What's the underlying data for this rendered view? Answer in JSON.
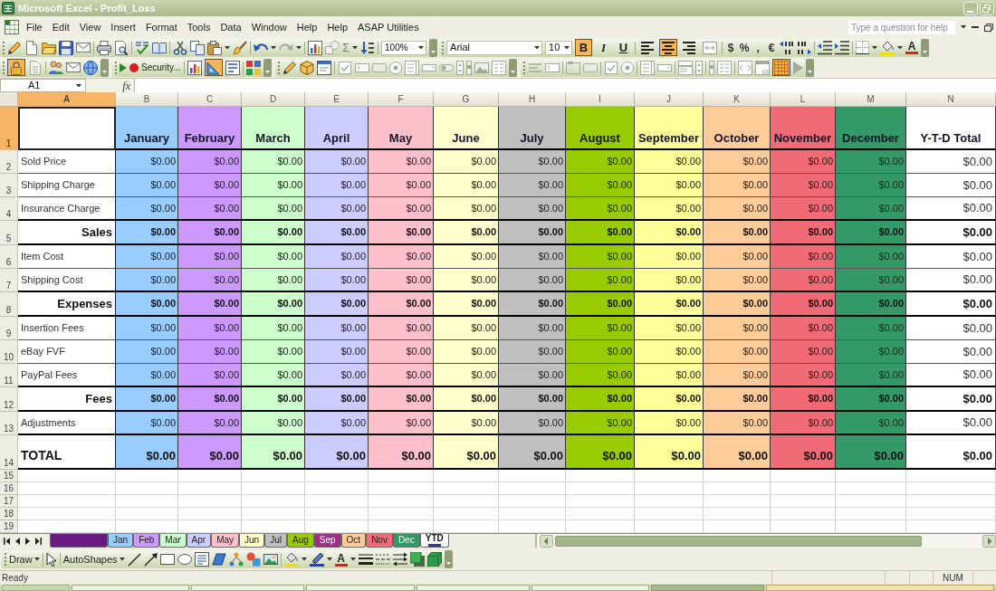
{
  "window": {
    "title": "Microsoft Excel - Profit_Loss"
  },
  "menu_bar": {
    "items": [
      "File",
      "Edit",
      "View",
      "Insert",
      "Format",
      "Tools",
      "Data",
      "Window",
      "Help",
      "Help",
      "ASAP Utilities"
    ],
    "help_box": {
      "placeholder": "Type a question for help"
    }
  },
  "standard_toolbar": {
    "autosum": "Σ",
    "zoom": "100%"
  },
  "formatting_toolbar": {
    "font": "Arial",
    "size": "10",
    "style_buttons": [
      {
        "label": "B",
        "on": true
      },
      {
        "label": "I",
        "on": false
      },
      {
        "label": "U",
        "on": false
      }
    ],
    "alignment_buttons": [
      {
        "kind": "left",
        "on": false
      },
      {
        "kind": "center",
        "on": true
      },
      {
        "kind": "right",
        "on": false
      },
      {
        "kind": "merge",
        "on": false
      }
    ],
    "number_buttons": [
      "$",
      "%",
      ",",
      "€"
    ],
    "font_color": "A"
  },
  "toolbar_3": {
    "security": "Security...",
    "toggles": [
      {
        "kind": "padlock",
        "on": true
      },
      {
        "kind": "set-square",
        "on": true
      },
      {
        "kind": "grid",
        "on": true
      }
    ]
  },
  "formula_bar": {
    "name_box": "A1",
    "function_label": "fx"
  },
  "sheet": {
    "columns": [
      {
        "label": "A",
        "selected": true
      },
      {
        "label": "B",
        "selected": false
      },
      {
        "label": "C",
        "selected": false
      },
      {
        "label": "D",
        "selected": false
      },
      {
        "label": "E",
        "selected": false
      },
      {
        "label": "F",
        "selected": false
      },
      {
        "label": "G",
        "selected": false
      },
      {
        "label": "H",
        "selected": false
      },
      {
        "label": "I",
        "selected": false
      },
      {
        "label": "J",
        "selected": false
      },
      {
        "label": "K",
        "selected": false
      },
      {
        "label": "L",
        "selected": false
      },
      {
        "label": "M",
        "selected": false
      },
      {
        "label": "N",
        "selected": false
      }
    ],
    "row_headers": [
      {
        "label": "1",
        "selected": true
      },
      {
        "label": "2",
        "selected": false
      },
      {
        "label": "3",
        "selected": false
      },
      {
        "label": "4",
        "selected": false
      },
      {
        "label": "5",
        "selected": false
      },
      {
        "label": "6",
        "selected": false
      },
      {
        "label": "7",
        "selected": false
      },
      {
        "label": "8",
        "selected": false
      },
      {
        "label": "9",
        "selected": false
      },
      {
        "label": "10",
        "selected": false
      },
      {
        "label": "11",
        "selected": false
      },
      {
        "label": "12",
        "selected": false
      },
      {
        "label": "13",
        "selected": false
      },
      {
        "label": "14",
        "selected": false
      },
      {
        "label": "15",
        "selected": false
      },
      {
        "label": "16",
        "selected": false
      },
      {
        "label": "17",
        "selected": false
      },
      {
        "label": "18",
        "selected": false
      },
      {
        "label": "19",
        "selected": false
      }
    ],
    "months": [
      {
        "label": "January",
        "color": "#99ccff"
      },
      {
        "label": "February",
        "color": "#cc99ff"
      },
      {
        "label": "March",
        "color": "#ccffcc"
      },
      {
        "label": "April",
        "color": "#ccccff"
      },
      {
        "label": "May",
        "color": "#ffc0cb"
      },
      {
        "label": "June",
        "color": "#ffffcc"
      },
      {
        "label": "July",
        "color": "#bfbfbf"
      },
      {
        "label": "August",
        "color": "#99cc00"
      },
      {
        "label": "September",
        "color": "#ffff99"
      },
      {
        "label": "October",
        "color": "#ffcc99"
      },
      {
        "label": "November",
        "color": "#f06b75"
      },
      {
        "label": "December",
        "color": "#339966"
      },
      {
        "label": "Y-T-D Total",
        "color": "#ffffff"
      }
    ],
    "rows": [
      {
        "label": "Sold Price",
        "kind": "item",
        "values": [
          "$0.00",
          "$0.00",
          "$0.00",
          "$0.00",
          "$0.00",
          "$0.00",
          "$0.00",
          "$0.00",
          "$0.00",
          "$0.00",
          "$0.00",
          "$0.00",
          "$0.00"
        ]
      },
      {
        "label": "Shipping Charge",
        "kind": "item",
        "values": [
          "$0.00",
          "$0.00",
          "$0.00",
          "$0.00",
          "$0.00",
          "$0.00",
          "$0.00",
          "$0.00",
          "$0.00",
          "$0.00",
          "$0.00",
          "$0.00",
          "$0.00"
        ]
      },
      {
        "label": "Insurance Charge",
        "kind": "item",
        "values": [
          "$0.00",
          "$0.00",
          "$0.00",
          "$0.00",
          "$0.00",
          "$0.00",
          "$0.00",
          "$0.00",
          "$0.00",
          "$0.00",
          "$0.00",
          "$0.00",
          "$0.00"
        ]
      },
      {
        "label": "Sales",
        "kind": "subtotal",
        "values": [
          "$0.00",
          "$0.00",
          "$0.00",
          "$0.00",
          "$0.00",
          "$0.00",
          "$0.00",
          "$0.00",
          "$0.00",
          "$0.00",
          "$0.00",
          "$0.00",
          "$0.00"
        ]
      },
      {
        "label": "Item Cost",
        "kind": "item",
        "values": [
          "$0.00",
          "$0.00",
          "$0.00",
          "$0.00",
          "$0.00",
          "$0.00",
          "$0.00",
          "$0.00",
          "$0.00",
          "$0.00",
          "$0.00",
          "$0.00",
          "$0.00"
        ]
      },
      {
        "label": "Shipping Cost",
        "kind": "item",
        "values": [
          "$0.00",
          "$0.00",
          "$0.00",
          "$0.00",
          "$0.00",
          "$0.00",
          "$0.00",
          "$0.00",
          "$0.00",
          "$0.00",
          "$0.00",
          "$0.00",
          "$0.00"
        ]
      },
      {
        "label": "Expenses",
        "kind": "subtotal",
        "values": [
          "$0.00",
          "$0.00",
          "$0.00",
          "$0.00",
          "$0.00",
          "$0.00",
          "$0.00",
          "$0.00",
          "$0.00",
          "$0.00",
          "$0.00",
          "$0.00",
          "$0.00"
        ]
      },
      {
        "label": "Insertion Fees",
        "kind": "item",
        "values": [
          "$0.00",
          "$0.00",
          "$0.00",
          "$0.00",
          "$0.00",
          "$0.00",
          "$0.00",
          "$0.00",
          "$0.00",
          "$0.00",
          "$0.00",
          "$0.00",
          "$0.00"
        ]
      },
      {
        "label": "eBay FVF",
        "kind": "item",
        "values": [
          "$0.00",
          "$0.00",
          "$0.00",
          "$0.00",
          "$0.00",
          "$0.00",
          "$0.00",
          "$0.00",
          "$0.00",
          "$0.00",
          "$0.00",
          "$0.00",
          "$0.00"
        ]
      },
      {
        "label": "PayPal Fees",
        "kind": "item",
        "values": [
          "$0.00",
          "$0.00",
          "$0.00",
          "$0.00",
          "$0.00",
          "$0.00",
          "$0.00",
          "$0.00",
          "$0.00",
          "$0.00",
          "$0.00",
          "$0.00",
          "$0.00"
        ]
      },
      {
        "label": "Fees",
        "kind": "subtotal",
        "values": [
          "$0.00",
          "$0.00",
          "$0.00",
          "$0.00",
          "$0.00",
          "$0.00",
          "$0.00",
          "$0.00",
          "$0.00",
          "$0.00",
          "$0.00",
          "$0.00",
          "$0.00"
        ]
      },
      {
        "label": "Adjustments",
        "kind": "item",
        "values": [
          "$0.00",
          "$0.00",
          "$0.00",
          "$0.00",
          "$0.00",
          "$0.00",
          "$0.00",
          "$0.00",
          "$0.00",
          "$0.00",
          "$0.00",
          "$0.00",
          "$0.00"
        ]
      },
      {
        "label": "TOTAL",
        "kind": "total",
        "values": [
          "$0.00",
          "$0.00",
          "$0.00",
          "$0.00",
          "$0.00",
          "$0.00",
          "$0.00",
          "$0.00",
          "$0.00",
          "$0.00",
          "$0.00",
          "$0.00",
          "$0.00"
        ]
      }
    ]
  },
  "sheet_tabs": [
    {
      "color": "#6a1b7f",
      "selected": false
    },
    {
      "label": "Jan",
      "color": "#99ccff",
      "selected": false
    },
    {
      "label": "Feb",
      "color": "#cc99ff",
      "selected": false
    },
    {
      "label": "Mar",
      "color": "#ccffcc",
      "selected": false
    },
    {
      "label": "Apr",
      "color": "#ccccff",
      "selected": false
    },
    {
      "label": "May",
      "color": "#ffc0cb",
      "selected": false
    },
    {
      "label": "Jun",
      "color": "#ffffcc",
      "selected": false
    },
    {
      "label": "Jul",
      "color": "#bfbfbf",
      "selected": false
    },
    {
      "label": "Aug",
      "color": "#99cc00",
      "selected": false
    },
    {
      "label": "Sep",
      "color": "#9c2f86",
      "selected": false
    },
    {
      "label": "Oct",
      "color": "#ffcc99",
      "selected": false
    },
    {
      "label": "Nov",
      "color": "#f06b75",
      "selected": false
    },
    {
      "label": "Dec",
      "color": "#339966",
      "selected": false
    },
    {
      "label": "YTD",
      "color": "#2a3f9a",
      "selected": true
    }
  ],
  "drawing_toolbar": {
    "draw": "Draw",
    "autoshapes": "AutoShapes",
    "font_color": "A"
  },
  "status_bar": {
    "status": "Ready",
    "indicator": "NUM"
  }
}
